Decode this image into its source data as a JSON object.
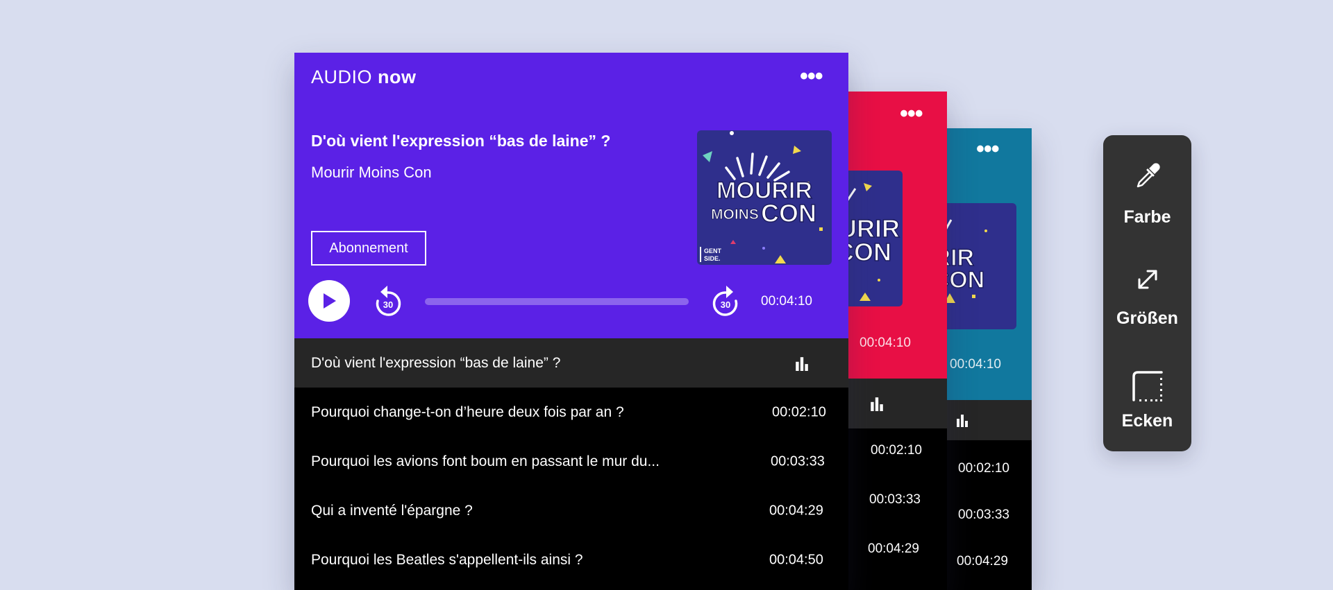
{
  "brand": {
    "logo_part1": "AUDIO",
    "logo_part2": "now"
  },
  "player": {
    "episode_title": "D'où vient l'expression “bas de laine” ?",
    "show_name": "Mourir Moins Con",
    "subscribe_label": "Abonnement",
    "skip_back_label": "30",
    "skip_forward_label": "30",
    "current_time": "00:04:10",
    "progress_fraction": 0.0
  },
  "artwork": {
    "line1": "MOURIR",
    "line2a": "MOINS",
    "line2b": "CON",
    "badge1": "GENT",
    "badge2": "SIDE."
  },
  "playlist": [
    {
      "title": "D'où vient l'expression “bas de laine” ?",
      "time": "",
      "active": true
    },
    {
      "title": "Pourquoi change-t-on d’heure deux fois par an ?",
      "time": "00:02:10"
    },
    {
      "title": "Pourquoi les avions font boum en passant le mur du...",
      "time": "00:03:33"
    },
    {
      "title": "Qui a inventé l'épargne ?",
      "time": "00:04:29"
    },
    {
      "title": "Pourquoi les Beatles s'appellent-ils ainsi ?",
      "time": "00:04:50"
    }
  ],
  "card_red": {
    "color": "#e80f45",
    "current_time": "00:04:10",
    "times": [
      "00:02:10",
      "00:03:33",
      "00:04:29"
    ],
    "art_line1": "OURIR",
    "art_line2": "SCON"
  },
  "card_blue": {
    "color": "#11789e",
    "current_time": "00:04:10",
    "times": [
      "00:02:10",
      "00:03:33",
      "00:04:29"
    ],
    "art_line1": "URIR",
    "art_line2": "SCON"
  },
  "toolbar": {
    "color_label": "Farbe",
    "size_label": "Größen",
    "corners_label": "Ecken"
  },
  "colors": {
    "main": "#5b21e6",
    "red": "#e80f45",
    "blue": "#11789e",
    "toolbar": "#333333"
  }
}
